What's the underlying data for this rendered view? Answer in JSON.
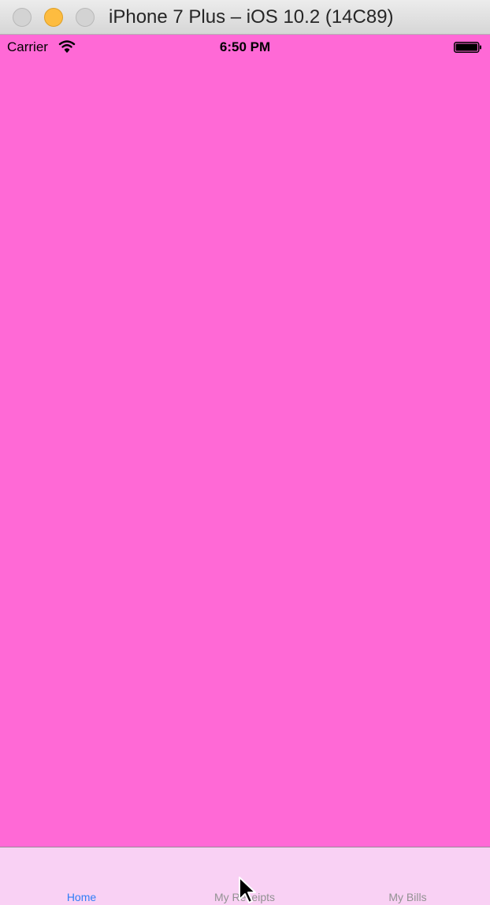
{
  "window": {
    "title": "iPhone 7 Plus – iOS 10.2 (14C89)"
  },
  "status_bar": {
    "carrier": "Carrier",
    "time": "6:50 PM",
    "battery_level": 1.0
  },
  "screen": {
    "background_color": "#ff69d6"
  },
  "tab_bar": {
    "background_color": "#f9d1f4",
    "selected_color": "#2f7ef6",
    "unselected_color": "#929292",
    "tabs": [
      {
        "label": "Home",
        "selected": true
      },
      {
        "label": "My Receipts",
        "selected": false
      },
      {
        "label": "My Bills",
        "selected": false
      }
    ]
  },
  "icons": {
    "wifi": "wifi-icon",
    "battery": "battery-icon",
    "cursor": "mouse-pointer-icon"
  }
}
